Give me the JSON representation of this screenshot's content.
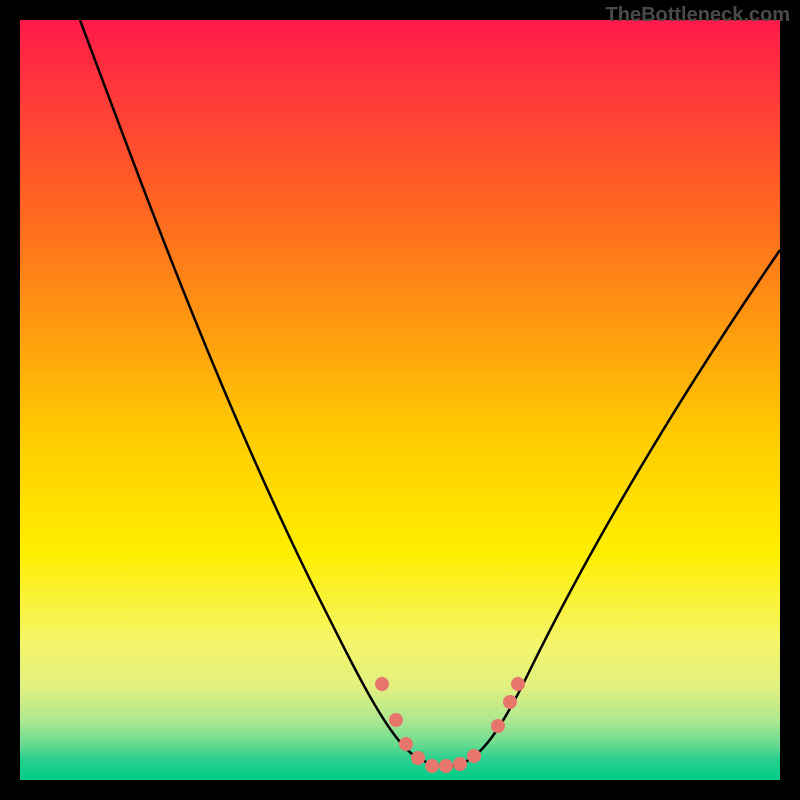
{
  "watermark": "TheBottleneck.com",
  "chart_data": {
    "type": "line",
    "title": "",
    "xlabel": "",
    "ylabel": "",
    "xlim": [
      0,
      100
    ],
    "ylim": [
      0,
      100
    ],
    "series": [
      {
        "name": "bottleneck-curve",
        "x": [
          8,
          15,
          22,
          30,
          38,
          44,
          48,
          51,
          53,
          55,
          57,
          59,
          62,
          66,
          72,
          80,
          90,
          100
        ],
        "y": [
          100,
          86,
          72,
          58,
          42,
          28,
          16,
          8,
          4,
          3,
          3,
          4,
          8,
          16,
          28,
          42,
          58,
          72
        ]
      }
    ],
    "markers": [
      {
        "name": "marker-left-1",
        "x": 48,
        "y": 14
      },
      {
        "name": "marker-left-2",
        "x": 50,
        "y": 9
      },
      {
        "name": "marker-left-3",
        "x": 51,
        "y": 6
      },
      {
        "name": "marker-trough-1",
        "x": 53,
        "y": 4
      },
      {
        "name": "marker-trough-2",
        "x": 55,
        "y": 3
      },
      {
        "name": "marker-trough-3",
        "x": 57,
        "y": 3
      },
      {
        "name": "marker-trough-4",
        "x": 59,
        "y": 4
      },
      {
        "name": "marker-right-1",
        "x": 62,
        "y": 8
      },
      {
        "name": "marker-right-2",
        "x": 63,
        "y": 11
      },
      {
        "name": "marker-right-3",
        "x": 64,
        "y": 14
      }
    ],
    "colors": {
      "curve": "#000000",
      "marker": "#e8766d"
    }
  }
}
